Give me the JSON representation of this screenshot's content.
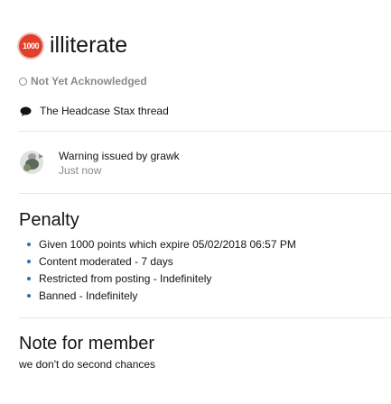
{
  "header": {
    "badge_text": "1000",
    "title": "illiterate"
  },
  "status": {
    "acknowledgement": "Not Yet Acknowledged"
  },
  "thread": {
    "title": "The Headcase Stax thread"
  },
  "warning": {
    "issued_by": "Warning issued by grawk",
    "time": "Just now"
  },
  "penalty": {
    "heading": "Penalty",
    "items": [
      "Given 1000 points which expire 05/02/2018 06:57 PM",
      "Content moderated - 7 days",
      "Restricted from posting - Indefinitely",
      "Banned - Indefinitely"
    ]
  },
  "note": {
    "heading": "Note for member",
    "text": "we don't do second chances"
  },
  "colors": {
    "badge": "#e0402b",
    "muted": "#8a8a8a",
    "bullet": "#2a6fb0"
  }
}
